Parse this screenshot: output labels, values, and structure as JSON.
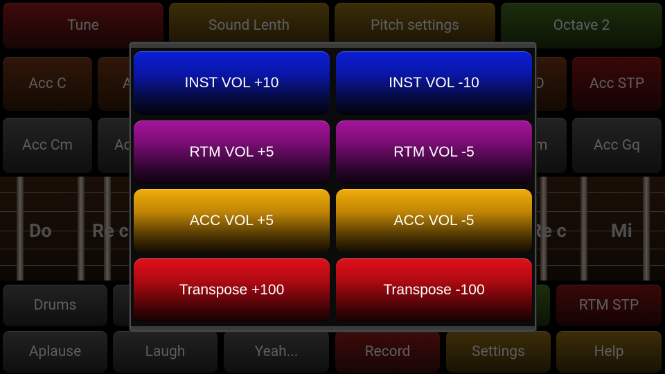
{
  "top_row": [
    "Tune",
    "Sound Lenth",
    "Pitch settings",
    "Octave 2"
  ],
  "row2": {
    "left": "Acc C",
    "left2": "A",
    "right_partial": "D",
    "right": "Acc STP"
  },
  "row3": {
    "left": "Acc Cm",
    "left2": "Ac",
    "right_partial": "m",
    "right": "Acc Gq"
  },
  "notes": {
    "do": "Do",
    "re_left": "Re c",
    "re_right": "Re c",
    "mi": "Mi"
  },
  "row5": {
    "drums": "Drums",
    "rtm_stp": "RTM STP"
  },
  "bottom_row": [
    "Aplause",
    "Laugh",
    "Yeah...",
    "Record",
    "Settings",
    "Help"
  ],
  "dialog": {
    "inst_up": "INST VOL +10",
    "inst_down": "INST VOL -10",
    "rtm_up": "RTM VOL +5",
    "rtm_down": "RTM VOL -5",
    "acc_up": "ACC VOL +5",
    "acc_down": "ACC VOL -5",
    "transpose_up": "Transpose +100",
    "transpose_down": "Transpose -100"
  }
}
